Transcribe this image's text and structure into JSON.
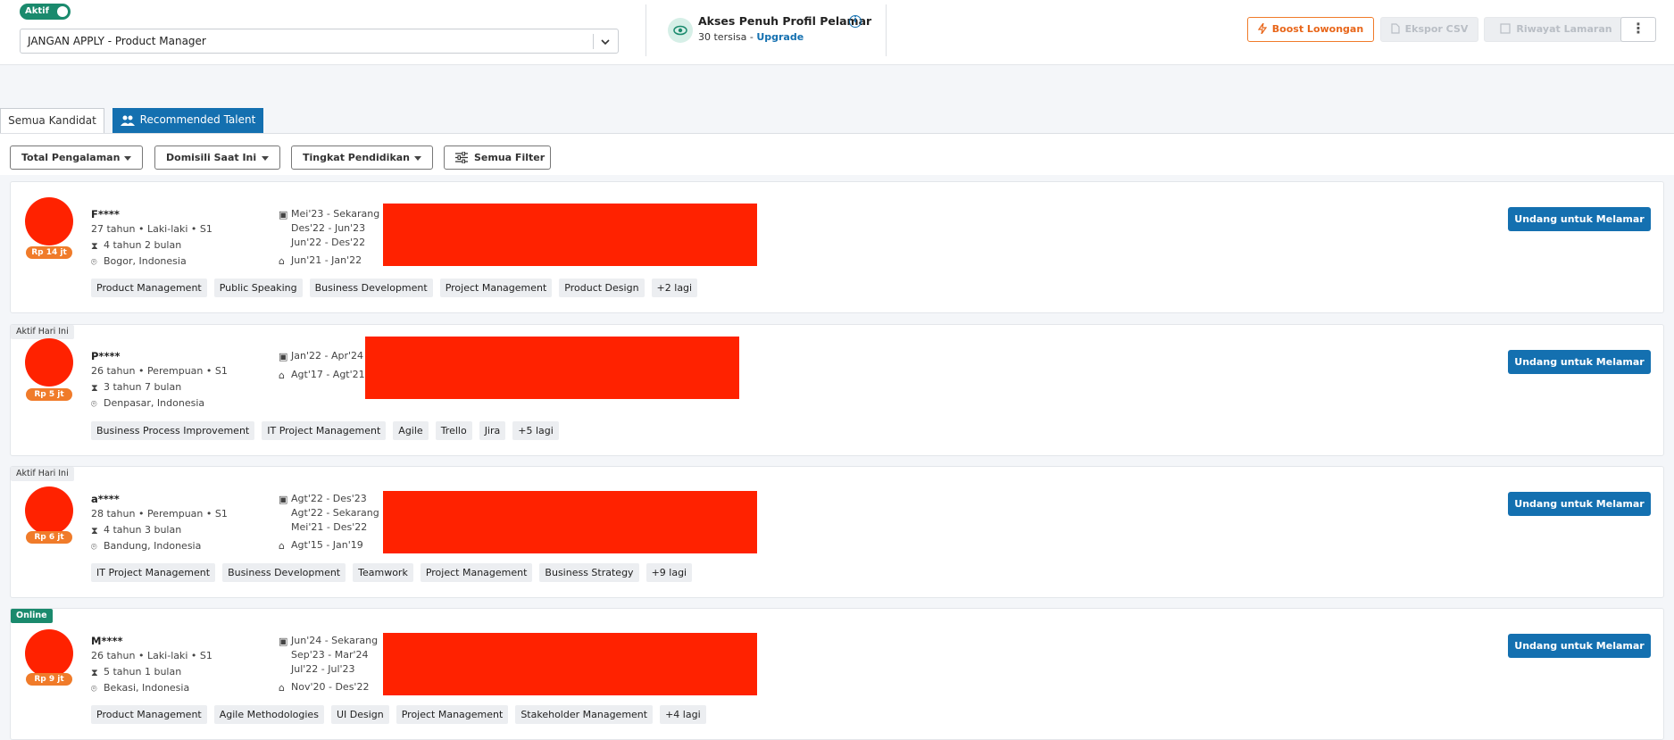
{
  "header": {
    "status_toggle": "Aktif",
    "job_select_value": "JANGAN APPLY - Product Manager",
    "access_title": "Akses Penuh Profil Pelamar",
    "access_remaining": "30 tersisa - ",
    "access_upgrade": "Upgrade",
    "boost_label": "Boost Lowongan",
    "export_label": "Ekspor CSV",
    "history_label": "Riwayat Lamaran",
    "more_label": "⋮"
  },
  "tabs": {
    "all": "Semua Kandidat",
    "recommended": "Recommended Talent"
  },
  "filters": {
    "experience": "Total Pengalaman",
    "domicile": "Domisili Saat Ini",
    "education": "Tingkat Pendidikan",
    "all": "Semua Filter"
  },
  "invite_label": "Undang untuk Melamar",
  "candidates": [
    {
      "tag": "",
      "salary": "Rp 14 jt",
      "name": "F****",
      "info": "27 tahun • Laki-laki • S1",
      "experience": "4 tahun 2 bulan",
      "location": "Bogor, Indonesia",
      "work": [
        "Mei'23 - Sekarang",
        "Des'22 - Jun'23",
        "Jun'22 - Des'22"
      ],
      "education": "Jun'21 - Jan'22",
      "skills": [
        "Product Management",
        "Public Speaking",
        "Business Development",
        "Project Management",
        "Product Design",
        "+2 lagi"
      ]
    },
    {
      "tag": "Aktif Hari Ini",
      "salary": "Rp 5 jt",
      "name": "P****",
      "info": "26 tahun • Perempuan • S1",
      "experience": "3 tahun 7 bulan",
      "location": "Denpasar, Indonesia",
      "work": [
        "Jan'22 - Apr'24"
      ],
      "education": "Agt'17 - Agt'21",
      "skills": [
        "Business Process Improvement",
        "IT Project Management",
        "Agile",
        "Trello",
        "Jira",
        "+5 lagi"
      ]
    },
    {
      "tag": "Aktif Hari Ini",
      "salary": "Rp 6 jt",
      "name": "a****",
      "info": "28 tahun • Perempuan • S1",
      "experience": "4 tahun 3 bulan",
      "location": "Bandung, Indonesia",
      "work": [
        "Agt'22 - Des'23",
        "Agt'22 - Sekarang",
        "Mei'21 - Des'22"
      ],
      "education": "Agt'15 - Jan'19",
      "skills": [
        "IT Project Management",
        "Business Development",
        "Teamwork",
        "Project Management",
        "Business Strategy",
        "+9 lagi"
      ]
    },
    {
      "tag": "Online",
      "salary": "Rp 9 jt",
      "name": "M****",
      "info": "26 tahun • Laki-laki • S1",
      "experience": "5 tahun 1 bulan",
      "location": "Bekasi, Indonesia",
      "work": [
        "Jun'24 - Sekarang",
        "Sep'23 - Mar'24",
        "Jul'22 - Jul'23"
      ],
      "education": "Nov'20 - Des'22",
      "skills": [
        "Product Management",
        "Agile Methodologies",
        "UI Design",
        "Project Management",
        "Stakeholder Management",
        "+4 lagi"
      ]
    }
  ]
}
